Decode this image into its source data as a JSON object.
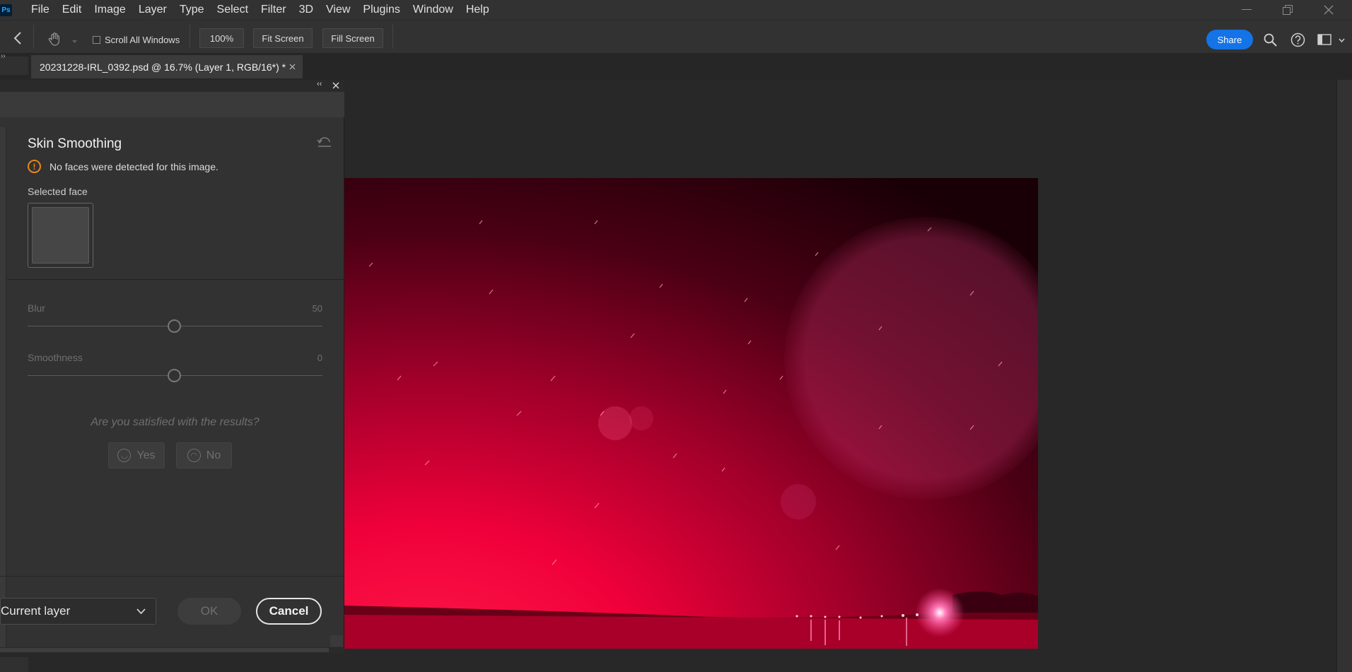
{
  "app": {
    "logo": "Ps"
  },
  "menu": [
    "File",
    "Edit",
    "Image",
    "Layer",
    "Type",
    "Select",
    "Filter",
    "3D",
    "View",
    "Plugins",
    "Window",
    "Help"
  ],
  "options_bar": {
    "scroll_all_windows": "Scroll All Windows",
    "zoom": "100%",
    "fit_screen": "Fit Screen",
    "fill_screen": "Fill Screen",
    "share": "Share"
  },
  "document_tab": {
    "title": "20231228-IRL_0392.psd @ 16.7% (Layer 1, RGB/16*) *"
  },
  "panel": {
    "title": "Skin Smoothing",
    "warning": "No faces were detected for this image.",
    "selected_face_label": "Selected face",
    "blur": {
      "label": "Blur",
      "value": "50"
    },
    "smoothness": {
      "label": "Smoothness",
      "value": "0"
    },
    "question": "Are you satisfied with the results?",
    "yes": "Yes",
    "no": "No",
    "output": "Current layer",
    "ok": "OK",
    "cancel": "Cancel"
  },
  "colors": {
    "accent": "#1473e6",
    "warning": "#e68619",
    "background": "#323232"
  }
}
